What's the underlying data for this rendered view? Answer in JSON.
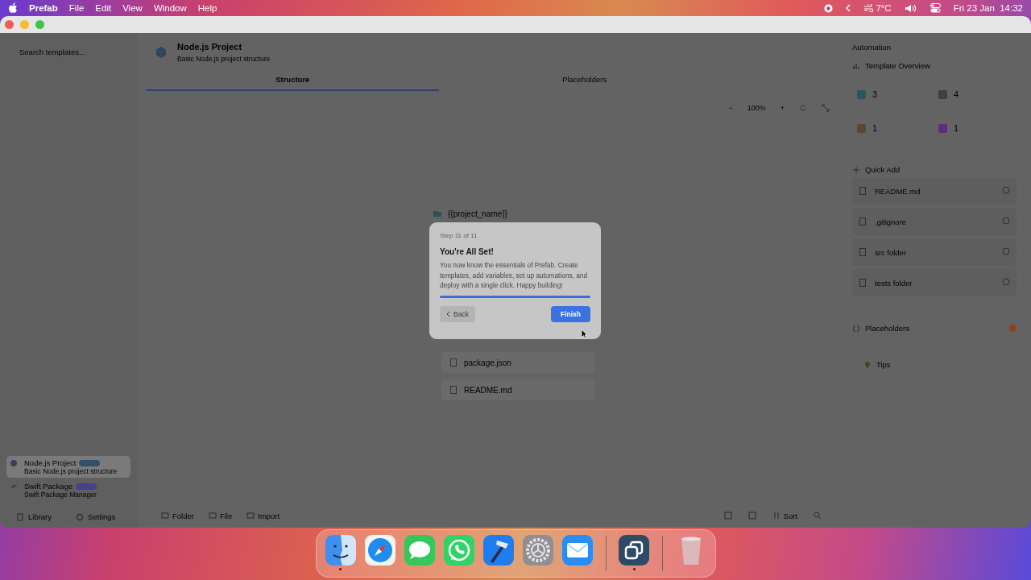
{
  "menu_bar": {
    "app": "Prefab",
    "menus": [
      "File",
      "Edit",
      "View",
      "Window",
      "Help"
    ],
    "weather": "7°C",
    "clock": "Fri 23 Jan  14:32"
  },
  "sidebar": {
    "search": {
      "placeholder": "Search templates..."
    },
    "templates": [
      {
        "name": "Node.js Project",
        "description": "Basic Node.js project structure",
        "color": "#33506b",
        "selected": true
      },
      {
        "name": "Swift Package",
        "description": "Swift Package Manager",
        "color": "#45418a",
        "selected": false
      }
    ],
    "footer": [
      "Library",
      "Settings"
    ]
  },
  "editor": {
    "title": "Node.js Project",
    "subtitle": "Basic Node.js project structure",
    "tabs": [
      {
        "label": "Structure",
        "selected": true
      },
      {
        "label": "Placeholders",
        "selected": false
      }
    ],
    "zoom_out": "−",
    "zoom": "100%",
    "zoom_in": "+",
    "tree": [
      {
        "name": "{{project_name}}",
        "kind": "folder"
      },
      {
        "name": "package.json",
        "kind": "file"
      },
      {
        "name": "README.md",
        "kind": "file"
      }
    ],
    "toolbar": [
      "Folder",
      "File",
      "Import"
    ],
    "sort": "Sort"
  },
  "inspector": {
    "tab": "Automation",
    "overview_title": "Template Overview",
    "stats": [
      {
        "value": "3",
        "color": "#2c5560"
      },
      {
        "value": "4",
        "color": "#3a3f48"
      },
      {
        "value": "1",
        "color": "#5a4a2c"
      },
      {
        "value": "1",
        "color": "#5a2f78"
      }
    ],
    "quick_add_title": "Quick Add",
    "quick_add": [
      {
        "name": "README.md"
      },
      {
        "name": ".gitignore"
      },
      {
        "name": "src folder"
      },
      {
        "name": "tests folder"
      }
    ],
    "placeholders_title": "Placeholders",
    "tips_title": "Tips"
  },
  "tour": {
    "step": "Step 11 of 11",
    "title": "You're All Set!",
    "body": "You now know the essentials of Prefab. Create templates, add variables, set up automations, and deploy with a single click. Happy building!",
    "level": 1,
    "back": "Back",
    "finish": "Finish"
  },
  "dock": {
    "groups": [
      {
        "apps": [
          {
            "kind": "finder",
            "running": true
          },
          {
            "kind": "safari",
            "running": false
          },
          {
            "kind": "messages",
            "running": false
          },
          {
            "kind": "whatsapp",
            "running": false
          },
          {
            "kind": "xcode",
            "running": false
          },
          {
            "kind": "settings",
            "running": false
          },
          {
            "kind": "mail",
            "running": false
          }
        ]
      },
      {
        "apps": [
          {
            "kind": "prefab",
            "running": true
          }
        ]
      },
      {
        "apps": [
          {
            "kind": "trash",
            "running": false
          }
        ]
      }
    ]
  }
}
